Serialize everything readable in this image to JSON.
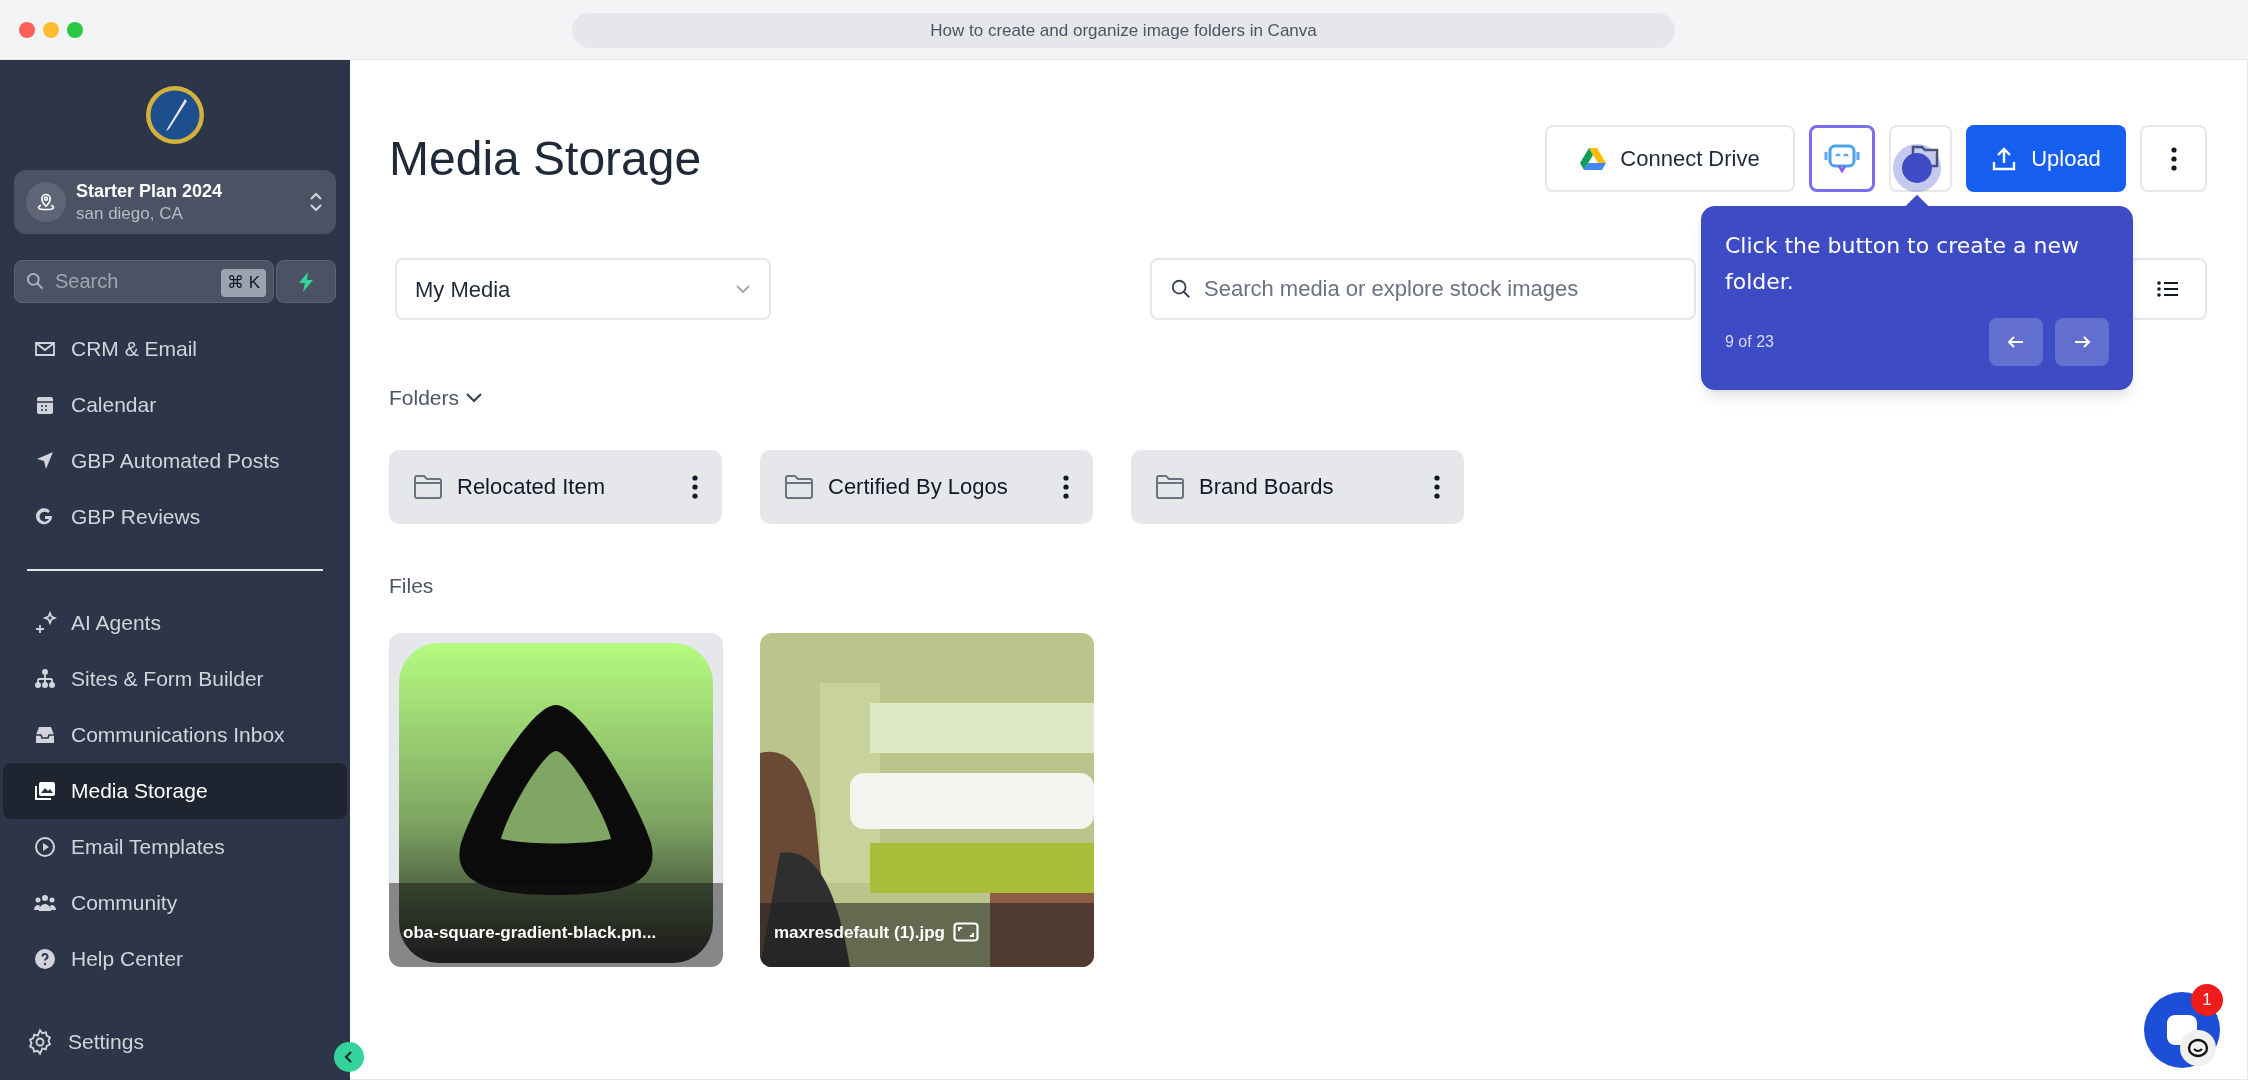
{
  "window": {
    "title": "How to create and organize image folders in Canva"
  },
  "sidebar": {
    "account": {
      "name": "Starter Plan 2024",
      "location": "san diego, CA"
    },
    "search": {
      "placeholder": "Search",
      "shortcut": "⌘ K"
    },
    "nav_groups": [
      [
        {
          "label": "CRM & Email",
          "selected": false
        },
        {
          "label": "Calendar",
          "selected": false
        },
        {
          "label": "GBP Automated Posts",
          "selected": false
        },
        {
          "label": "GBP Reviews",
          "selected": false
        }
      ],
      [
        {
          "label": "AI Agents",
          "selected": false
        },
        {
          "label": "Sites & Form Builder",
          "selected": false
        },
        {
          "label": "Communications Inbox",
          "selected": false
        },
        {
          "label": "Media Storage",
          "selected": true
        },
        {
          "label": "Email Templates",
          "selected": false
        },
        {
          "label": "Community",
          "selected": false
        },
        {
          "label": "Help Center",
          "selected": false
        }
      ]
    ],
    "settings": "Settings"
  },
  "main": {
    "title": "Media Storage",
    "connect_button": "Connect Drive",
    "upload_button": "Upload",
    "source_dropdown": "My Media",
    "search": {
      "placeholder": "Search media or explore stock images"
    },
    "folders_heading": "Folders",
    "folders": [
      {
        "name": "Relocated Item"
      },
      {
        "name": "Certified By Logos"
      },
      {
        "name": "Brand Boards"
      }
    ],
    "files_heading": "Files",
    "files": [
      {
        "name": "oba-square-gradient-black.pn...",
        "aspect_icon": false
      },
      {
        "name": "maxresdefault (1).jpg",
        "aspect_icon": true
      }
    ]
  },
  "tour_tooltip": {
    "text": "Click the button to create a new folder.",
    "step": "9 of 23"
  },
  "chat_widget": {
    "badge": "1"
  }
}
